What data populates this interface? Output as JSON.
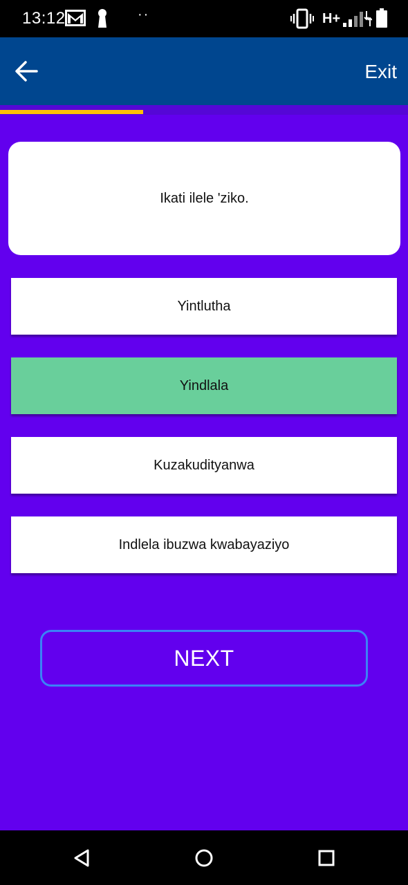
{
  "status_bar": {
    "time": "13:12",
    "network_type": "H+",
    "icons": [
      "gmail-icon",
      "key-icon",
      "vibrate-icon",
      "signal-icon",
      "battery-icon"
    ]
  },
  "app_bar": {
    "back_icon": "arrow-back-icon",
    "exit_label": "Exit",
    "background": "#00468f"
  },
  "progress": {
    "fraction": 0.35,
    "color": "#ffc107"
  },
  "question": {
    "text": "Ikati ilele 'ziko."
  },
  "options": [
    {
      "label": "Yintlutha",
      "selected": false
    },
    {
      "label": "Yindlala",
      "selected": true
    },
    {
      "label": "Kuzakudityanwa",
      "selected": false
    },
    {
      "label": "Indlela ibuzwa kwabayaziyo",
      "selected": false
    }
  ],
  "next_button": {
    "label": "NEXT"
  },
  "nav_bar": {
    "icons": [
      "back-triangle-icon",
      "home-circle-icon",
      "recents-square-icon"
    ]
  },
  "colors": {
    "background": "#6200ee",
    "selected_option": "#69cf9b",
    "next_border": "#3b82f6"
  }
}
